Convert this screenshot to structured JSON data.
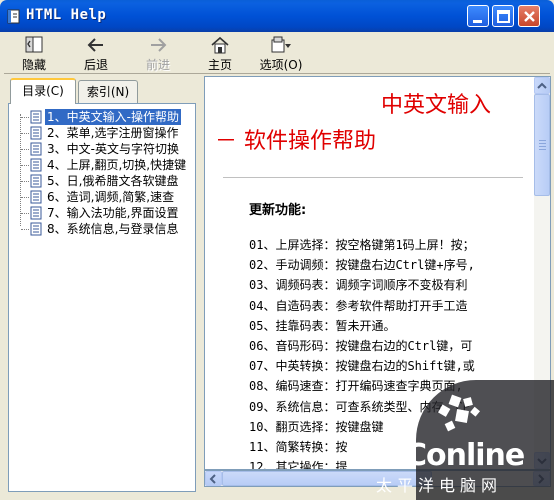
{
  "window": {
    "title": "HTML Help"
  },
  "toolbar": {
    "hide": "隐藏",
    "back": "后退",
    "forward": "前进",
    "home": "主页",
    "options": "选项(O)"
  },
  "nav": {
    "tabs": [
      {
        "label": "目录(C)",
        "active": true
      },
      {
        "label": "索引(N)",
        "active": false
      }
    ],
    "items": [
      {
        "label": "1、中英文输入-操作帮助",
        "selected": true
      },
      {
        "label": "2、菜单,选字注册窗操作",
        "selected": false
      },
      {
        "label": "3、中文-英文与字符切换",
        "selected": false
      },
      {
        "label": "4、上屏,翻页,切换,快捷键",
        "selected": false
      },
      {
        "label": "5、日,俄希腊文各软键盘",
        "selected": false
      },
      {
        "label": "6、造词,调频,简繁,速查",
        "selected": false
      },
      {
        "label": "7、输入法功能,界面设置",
        "selected": false
      },
      {
        "label": "8、系统信息,与登录信息",
        "selected": false
      }
    ]
  },
  "content": {
    "title_line1": "中英文输入",
    "title_line2": "－ 软件操作帮助",
    "heading": "更新功能:",
    "items": [
      "01、上屏选择：按空格键第1码上屏！按；",
      "02、手动调频：按键盘右边Ctrl键+序号,",
      "03、调频码表：调频字词顺序不变极有利",
      "04、自造码表：参考软件帮助打开手工造",
      "05、挂靠码表：暂未开通。",
      "06、音码形码：按键盘右边的Ctrl键，可",
      "07、中英转换：按键盘右边的Shift键,或",
      "08、编码速查：打开编码速查字典页面,",
      "09、系统信息：可查系统类型、内存、CP",
      "10、翻页选择：按键盘键",
      "11、简繁转换：按",
      "12、其它操作：提"
    ]
  },
  "watermark": {
    "brand": "PConline",
    "sub": "太平洋电脑网"
  },
  "colors": {
    "titlebar": "#0a5fd8",
    "title_red": "#e00000",
    "selection": "#316ac5",
    "window_bg": "#ece9d8"
  }
}
